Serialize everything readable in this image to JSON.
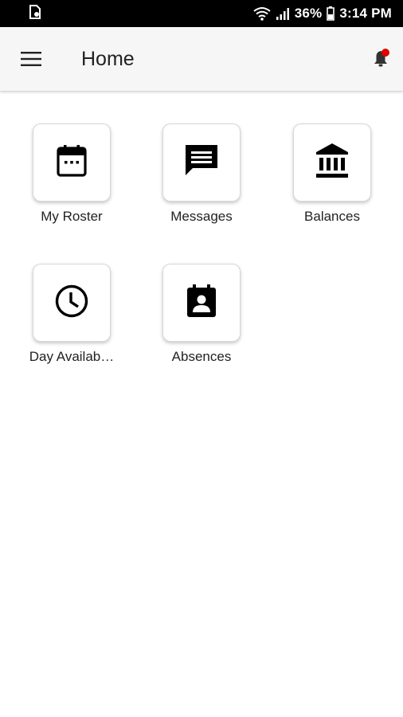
{
  "status_bar": {
    "battery_percent": "36%",
    "time": "3:14 PM",
    "icons": [
      "sim-card-icon",
      "wifi-icon",
      "signal-icon",
      "battery-icon"
    ]
  },
  "app_bar": {
    "title": "Home",
    "menu_icon": "hamburger-menu-icon",
    "notification_icon": "bell-icon",
    "notification_dot_color": "#e00000"
  },
  "tiles": [
    {
      "label": "My Roster",
      "icon": "calendar-icon"
    },
    {
      "label": "Messages",
      "icon": "message-icon"
    },
    {
      "label": "Balances",
      "icon": "bank-icon"
    },
    {
      "label": "Day Availab…",
      "icon": "clock-icon"
    },
    {
      "label": "Absences",
      "icon": "contact-calendar-icon"
    }
  ]
}
